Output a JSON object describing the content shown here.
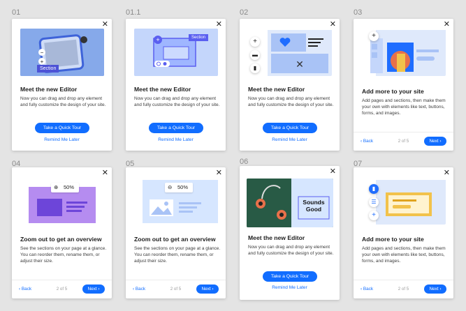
{
  "frames": [
    {
      "label": "01",
      "title": "Meet the new Editor",
      "desc": "Now you can drag and drop any element and fully customize the design of your site.",
      "cta": "Take a Quick Tour",
      "link": "Remind Me Later",
      "hero_text": "Section"
    },
    {
      "label": "01.1",
      "title": "Meet the new Editor",
      "desc": "Now you can drag and drop any element and fully customize the design of your site.",
      "cta": "Take a Quick Tour",
      "link": "Remind Me Later",
      "hero_text": "Section"
    },
    {
      "label": "02",
      "title": "Meet the new Editor",
      "desc": "Now you can drag and drop any element and fully customize the design of your site.",
      "cta": "Take a Quick Tour",
      "link": "Remind Me Later"
    },
    {
      "label": "03",
      "title": "Add more to your site",
      "desc": "Add pages and sections, then make them your own with elements like text, buttons, forms, and images.",
      "back": "Back",
      "step": "2 of 5",
      "next": "Next"
    },
    {
      "label": "04",
      "title": "Zoom out to get an overview",
      "desc": "See the sections on your page at a glance. You can reorder them, rename them, or adjust their size.",
      "back": "Back",
      "step": "2 of 5",
      "next": "Next",
      "zoom": "50%"
    },
    {
      "label": "05",
      "title": "Zoom out to get an overview",
      "desc": "See the sections on your page at a glance. You can reorder them, rename them, or adjust their size.",
      "back": "Back",
      "step": "2 of 5",
      "next": "Next",
      "zoom": "50%"
    },
    {
      "label": "06",
      "title": "Meet the new Editor",
      "desc": "Now you can drag and drop any element and fully customize the design of your site.",
      "cta": "Take a Quick Tour",
      "link": "Remind Me Later",
      "hero_text": "Sounds Good"
    },
    {
      "label": "07",
      "title": "Add more to your site",
      "desc": "Add pages and sections, then make them your own with elements like text, buttons, forms, and images.",
      "back": "Back",
      "step": "2 of 5",
      "next": "Next"
    }
  ],
  "icons": {
    "close": "close-icon",
    "plus": "plus-icon",
    "zoom": "zoom-icon",
    "back": "chevron-left-icon",
    "next": "chevron-right-icon"
  },
  "colors": {
    "accent": "#116dff",
    "purple": "#b58cf0",
    "light_blue": "#d6e6ff"
  }
}
